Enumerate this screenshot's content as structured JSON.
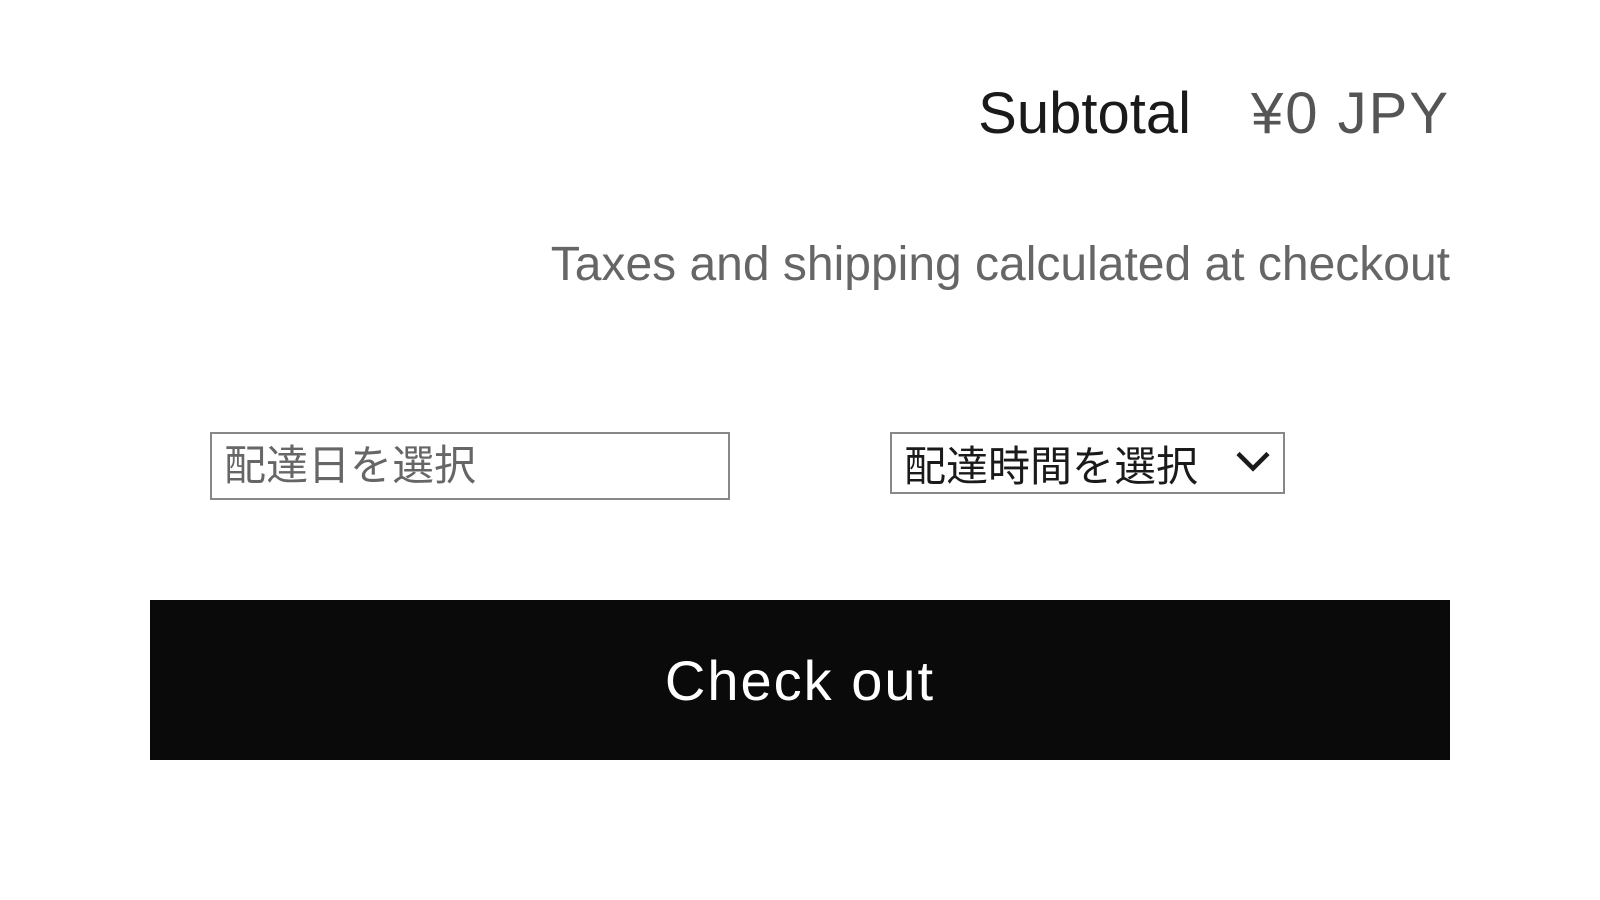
{
  "subtotal": {
    "label": "Subtotal",
    "value": "¥0 JPY"
  },
  "tax_note": "Taxes and shipping calculated at checkout",
  "delivery": {
    "date_placeholder": "配達日を選択",
    "time_label": "配達時間を選択"
  },
  "checkout_label": "Check out"
}
